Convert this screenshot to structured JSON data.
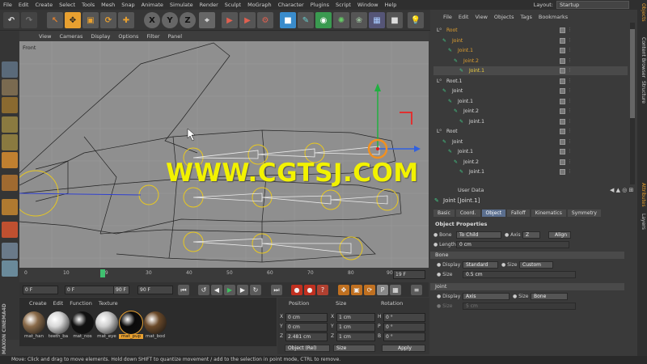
{
  "menubar": [
    "File",
    "Edit",
    "Create",
    "Select",
    "Tools",
    "Mesh",
    "Snap",
    "Animate",
    "Simulate",
    "Render",
    "Sculpt",
    "MoGraph",
    "Character",
    "Plugins",
    "Script",
    "Window",
    "Help"
  ],
  "layout": {
    "label": "Layout:",
    "value": "Startup"
  },
  "toolbar": {
    "x": "X",
    "y": "Y",
    "z": "Z"
  },
  "viewport": {
    "menu": [
      "View",
      "Cameras",
      "Display",
      "Options",
      "Filter",
      "Panel"
    ],
    "label": "Front"
  },
  "watermark": "WWW.CGTSJ.COM",
  "timeline": {
    "ticks": [
      "0",
      "10",
      "19",
      "30",
      "40",
      "50",
      "60",
      "70",
      "80",
      "90"
    ],
    "end_frame": "19 F"
  },
  "playbar": {
    "start": "0 F",
    "current": "0 F",
    "max": "90 F",
    "end": "90 F"
  },
  "materials": {
    "menu": [
      "Create",
      "Edit",
      "Function",
      "Texture"
    ],
    "items": [
      {
        "name": "mat_han",
        "color": "#8a6b4a"
      },
      {
        "name": "teeth_ba",
        "color": "#d8d8d8"
      },
      {
        "name": "mat_nos",
        "color": "#111111"
      },
      {
        "name": "mat_eye",
        "color": "#cfcfcf"
      },
      {
        "name": "mat_pup",
        "color": "#0a0a0a"
      },
      {
        "name": "mat_bod",
        "color": "#6b4a2a"
      }
    ],
    "brand": "MAXON CINEMA4D"
  },
  "coords": {
    "headers": [
      "Position",
      "Size",
      "Rotation"
    ],
    "rows": [
      {
        "a": "X",
        "av": "0 cm",
        "b": "X",
        "bv": "1 cm",
        "c": "H",
        "cv": "0 °"
      },
      {
        "a": "Y",
        "av": "0 cm",
        "b": "Y",
        "bv": "1 cm",
        "c": "P",
        "cv": "0 °"
      },
      {
        "a": "Z",
        "av": "2.481 cm",
        "b": "Z",
        "bv": "1 cm",
        "c": "B",
        "cv": "0 °"
      }
    ],
    "mode": "Object (Rel)",
    "size_mode": "Size",
    "apply": "Apply"
  },
  "status": "Move: Click and drag to move elements. Hold down SHIFT to quantize movement / add to the selection in point mode, CTRL to remove.",
  "objects": {
    "menu": [
      "File",
      "Edit",
      "View",
      "Objects",
      "Tags",
      "Bookmarks"
    ],
    "rows": [
      {
        "label": "Root",
        "indent": 0,
        "color": "#e0a030"
      },
      {
        "label": "Joint",
        "indent": 1,
        "color": "#e0a030"
      },
      {
        "label": "Joint.1",
        "indent": 2,
        "color": "#e0a030"
      },
      {
        "label": "Joint.2",
        "indent": 3,
        "color": "#e0a030"
      },
      {
        "label": "Joint.1",
        "indent": 4,
        "color": "#f0d040"
      },
      {
        "label": "Root.1",
        "indent": 0,
        "color": "#dddddd"
      },
      {
        "label": "Joint",
        "indent": 1,
        "color": "#dddddd"
      },
      {
        "label": "Joint.1",
        "indent": 2,
        "color": "#dddddd"
      },
      {
        "label": "Joint.2",
        "indent": 3,
        "color": "#dddddd"
      },
      {
        "label": "Joint.1",
        "indent": 4,
        "color": "#dddddd"
      },
      {
        "label": "Root",
        "indent": 0,
        "color": "#dddddd"
      },
      {
        "label": "Joint",
        "indent": 1,
        "color": "#dddddd"
      },
      {
        "label": "Joint.1",
        "indent": 2,
        "color": "#dddddd"
      },
      {
        "label": "Joint.2",
        "indent": 3,
        "color": "#dddddd"
      },
      {
        "label": "Joint.1",
        "indent": 4,
        "color": "#dddddd"
      }
    ]
  },
  "sidetabs": [
    "Objects",
    "Content Browser",
    "Structure",
    "Attributes",
    "Layers"
  ],
  "attributes": {
    "menu": "User Data",
    "title": "Joint [Joint.1]",
    "tabs": [
      "Basic",
      "Coord.",
      "Object",
      "Falloff",
      "Kinematics",
      "Symmetry"
    ],
    "active_tab": "Object",
    "section": "Object Properties",
    "bone_label": "Bone",
    "bone_value": "To Child",
    "axis_label": "Axis",
    "axis_value": "Z",
    "align": "Align",
    "length_label": "Length",
    "length_value": "0 cm",
    "bone_section": "Bone",
    "display_label": "Display",
    "display_value": "Standard",
    "size_label": "Size",
    "size_value": "Custom",
    "size2_label": "Size",
    "size2_value": "0.5 cm",
    "joint_section": "Joint",
    "jdisplay_value": "Axis",
    "jsize_value": "Bone",
    "jsize2_value": "5 cm"
  }
}
